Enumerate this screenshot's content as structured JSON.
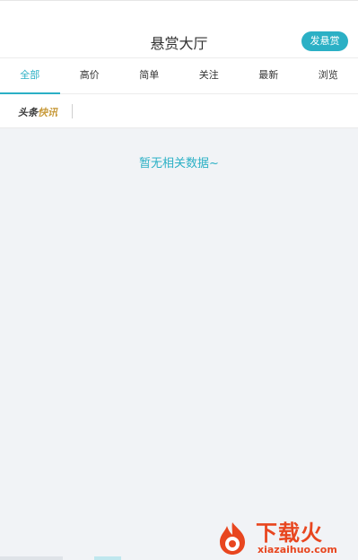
{
  "header": {
    "title": "悬赏大厅",
    "post_button": "发悬赏"
  },
  "tabs": [
    {
      "label": "全部",
      "active": true
    },
    {
      "label": "高价",
      "active": false
    },
    {
      "label": "简单",
      "active": false
    },
    {
      "label": "关注",
      "active": false
    },
    {
      "label": "最新",
      "active": false
    },
    {
      "label": "浏览",
      "active": false
    }
  ],
  "news_bar": {
    "label_head": "头条",
    "label_flash": "快讯"
  },
  "empty_message": "暂无相关数据~",
  "watermark": {
    "title": "下载火",
    "url": "xiazaihuo.com"
  },
  "colors": {
    "accent": "#2bb0c5",
    "news_flash": "#c89b3c",
    "watermark": "#e8461f",
    "background": "#f1f3f6"
  }
}
